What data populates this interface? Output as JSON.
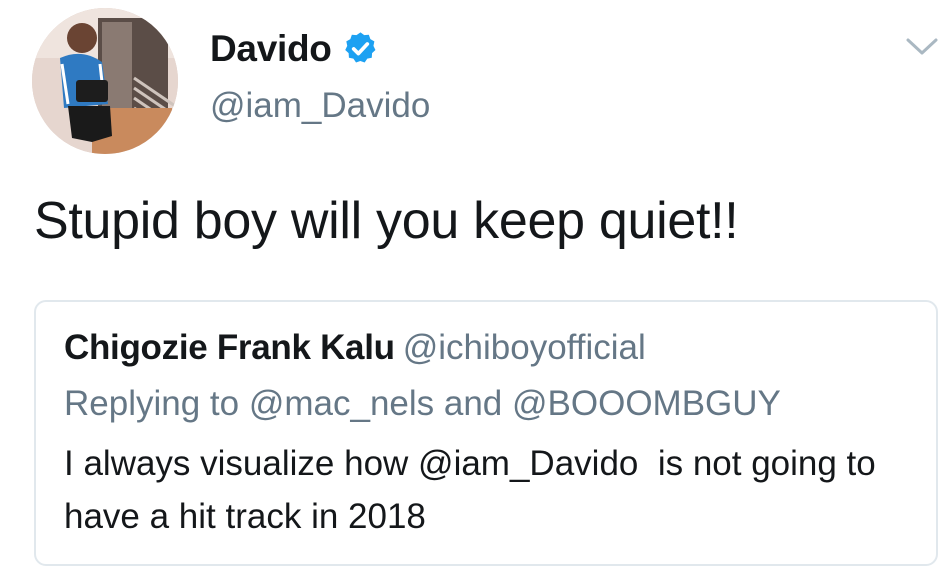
{
  "author": {
    "display_name": "Davido",
    "handle": "@iam_Davido",
    "verified": true
  },
  "tweet": {
    "text": "Stupid boy will you keep quiet!!"
  },
  "quoted_tweet": {
    "author_name": "Chigozie Frank Kalu",
    "author_handle": "@ichiboyofficial",
    "reply_context": "Replying to @mac_nels and @BOOOMBGUY",
    "text": "I always visualize how @iam_Davido  is not going to have a hit track in 2018"
  },
  "colors": {
    "primary_text": "#14171a",
    "secondary_text": "#657786",
    "verified_blue": "#1da1f2",
    "border": "#e1e8ed"
  },
  "icons": {
    "verified": "verified-badge-icon",
    "menu": "chevron-down-icon"
  }
}
